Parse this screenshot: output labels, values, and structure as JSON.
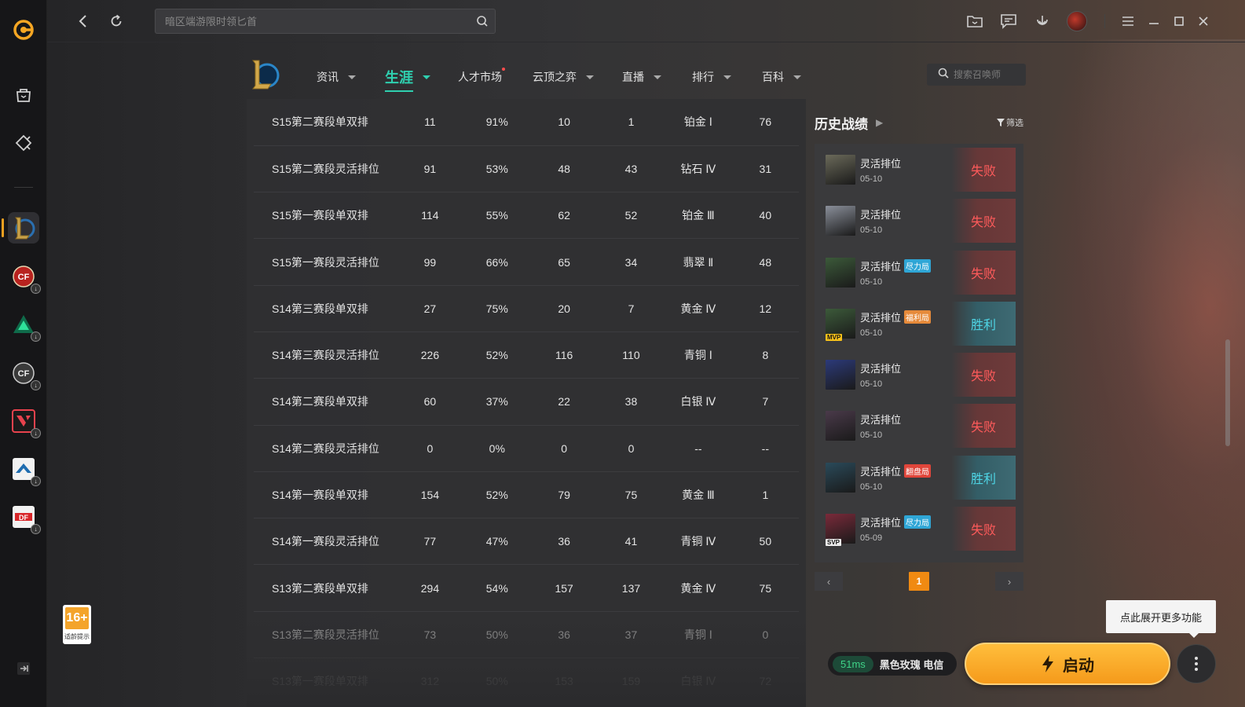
{
  "search": {
    "placeholder": "暗区端游限时领匕首"
  },
  "nav": {
    "items": [
      {
        "label": "资讯",
        "caret": true
      },
      {
        "label": "生涯",
        "caret": true,
        "active": true
      },
      {
        "label": "人才市场",
        "caret": false,
        "dot": true
      },
      {
        "label": "云顶之弈",
        "caret": true
      },
      {
        "label": "直播",
        "caret": true
      },
      {
        "label": "排行",
        "caret": true
      },
      {
        "label": "百科",
        "caret": true
      }
    ],
    "search_placeholder": "搜索召唤师"
  },
  "stats_rows": [
    [
      "S15第二赛段单双排",
      "11",
      "91%",
      "10",
      "1",
      "铂金 Ⅰ",
      "76"
    ],
    [
      "S15第二赛段灵活排位",
      "91",
      "53%",
      "48",
      "43",
      "钻石 Ⅳ",
      "31"
    ],
    [
      "S15第一赛段单双排",
      "114",
      "55%",
      "62",
      "52",
      "铂金 Ⅲ",
      "40"
    ],
    [
      "S15第一赛段灵活排位",
      "99",
      "66%",
      "65",
      "34",
      "翡翠 Ⅱ",
      "48"
    ],
    [
      "S14第三赛段单双排",
      "27",
      "75%",
      "20",
      "7",
      "黄金 Ⅳ",
      "12"
    ],
    [
      "S14第三赛段灵活排位",
      "226",
      "52%",
      "116",
      "110",
      "青铜 Ⅰ",
      "8"
    ],
    [
      "S14第二赛段单双排",
      "60",
      "37%",
      "22",
      "38",
      "白银 Ⅳ",
      "7"
    ],
    [
      "S14第二赛段灵活排位",
      "0",
      "0%",
      "0",
      "0",
      "--",
      "--"
    ],
    [
      "S14第一赛段单双排",
      "154",
      "52%",
      "79",
      "75",
      "黄金 Ⅲ",
      "1"
    ],
    [
      "S14第一赛段灵活排位",
      "77",
      "47%",
      "36",
      "41",
      "青铜 Ⅳ",
      "50"
    ],
    [
      "S13第二赛段单双排",
      "294",
      "54%",
      "157",
      "137",
      "黄金 Ⅳ",
      "75"
    ],
    [
      "S13第二赛段灵活排位",
      "73",
      "50%",
      "36",
      "37",
      "青铜 Ⅰ",
      "0"
    ],
    [
      "S13第一赛段单双排",
      "312",
      "50%",
      "153",
      "159",
      "白银 Ⅳ",
      "72"
    ]
  ],
  "history": {
    "title": "历史战绩",
    "filter_label": "筛选",
    "matches": [
      {
        "mode": "灵活排位",
        "date": "05-10",
        "result": "失败",
        "outcome": "lose",
        "portrait_color": "#6b6a5a"
      },
      {
        "mode": "灵活排位",
        "date": "05-10",
        "result": "失败",
        "outcome": "lose",
        "portrait_color": "#8a8f9a"
      },
      {
        "mode": "灵活排位",
        "badge": "尽力局",
        "badge_color": "#2fa6d6",
        "date": "05-10",
        "result": "失败",
        "outcome": "lose",
        "portrait_color": "#3c5a3a"
      },
      {
        "mode": "灵活排位",
        "badge": "福利局",
        "badge_color": "#e68a3a",
        "date": "05-10",
        "result": "胜利",
        "outcome": "win",
        "tag": "MVP",
        "portrait_color": "#3c5a3a"
      },
      {
        "mode": "灵活排位",
        "date": "05-10",
        "result": "失败",
        "outcome": "lose",
        "portrait_color": "#2c3a7a"
      },
      {
        "mode": "灵活排位",
        "date": "05-10",
        "result": "失败",
        "outcome": "lose",
        "portrait_color": "#4a3a4a"
      },
      {
        "mode": "灵活排位",
        "badge": "翻盘局",
        "badge_color": "#e0453a",
        "date": "05-10",
        "result": "胜利",
        "outcome": "win",
        "portrait_color": "#2a4a5a"
      },
      {
        "mode": "灵活排位",
        "badge": "尽力局",
        "badge_color": "#2fa6d6",
        "date": "05-09",
        "result": "失败",
        "outcome": "lose",
        "tag": "SVP",
        "portrait_color": "#7a2a3a"
      }
    ],
    "page": "1"
  },
  "bottom": {
    "tooltip": "点此展开更多功能",
    "ping": "51ms",
    "server": "黑色玫瑰 电信",
    "launch_label": "启动"
  },
  "age_rating": {
    "number": "16+",
    "text": "适龄提示"
  },
  "colors": {
    "accent": "#2fd0b0",
    "lose": "#ff5b5b",
    "win": "#4fd6e6",
    "launch": "#f59a1b"
  }
}
